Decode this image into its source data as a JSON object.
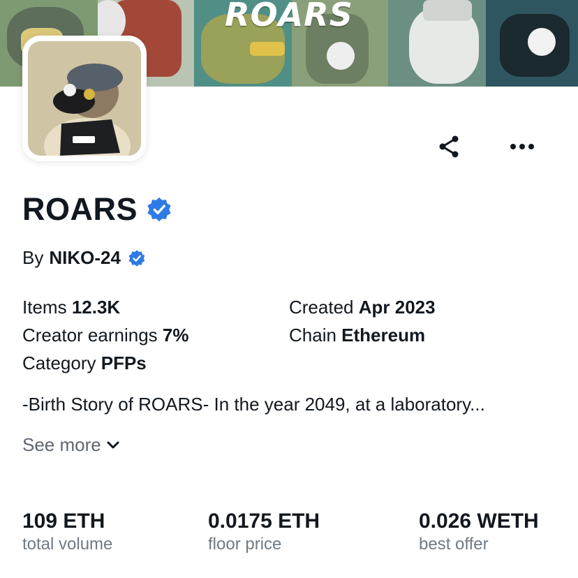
{
  "banner": {
    "title": "ROARS"
  },
  "collection": {
    "name": "ROARS",
    "by_label": "By",
    "creator": "NIKO-24",
    "verified_color": "#2e7be6"
  },
  "details": {
    "items_label": "Items",
    "items_value": "12.3K",
    "earnings_label": "Creator earnings",
    "earnings_value": "7%",
    "category_label": "Category",
    "category_value": "PFPs",
    "created_label": "Created",
    "created_value": "Apr 2023",
    "chain_label": "Chain",
    "chain_value": "Ethereum"
  },
  "description": "-Birth Story of ROARS- In the year 2049, at a laboratory...",
  "see_more_label": "See more",
  "icons": {
    "share": "share-icon",
    "more": "more-horizontal-icon",
    "chevron": "chevron-down-icon",
    "verified": "verified-badge-icon"
  },
  "stats": [
    {
      "value": "109 ETH",
      "label": "total volume"
    },
    {
      "value": "0.0175 ETH",
      "label": "floor price"
    },
    {
      "value": "0.026 WETH",
      "label": "best offer"
    }
  ]
}
